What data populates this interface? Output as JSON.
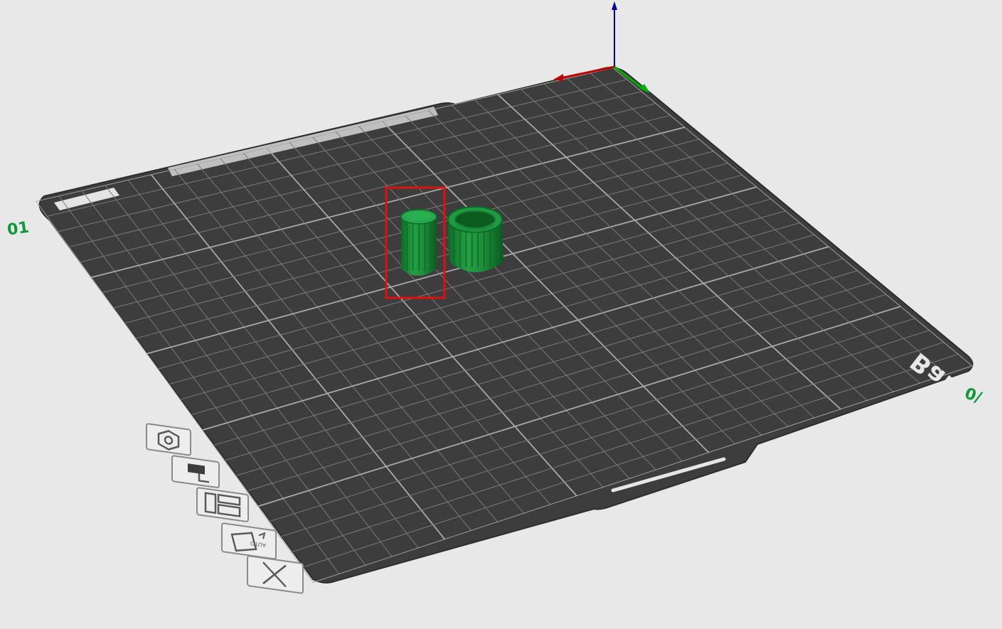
{
  "app": {
    "view": "3D Prepare View"
  },
  "plate": {
    "label": "Bambu Textured PEI Plate",
    "number_left": "01",
    "number_right": "0/"
  },
  "objects": [
    {
      "name": "knob-cylinder",
      "selected": true,
      "color": "#1f8f3a"
    },
    {
      "name": "ring-cylinder",
      "selected": false,
      "color": "#1f8f3a"
    }
  ],
  "side_toolbar": {
    "items": [
      {
        "name": "tool-orient",
        "icon": "hexagon-icon"
      },
      {
        "name": "tool-plate-settings",
        "icon": "plate-settings-icon"
      },
      {
        "name": "tool-arrange",
        "icon": "arrange-icon"
      },
      {
        "name": "tool-auto-orient",
        "icon": "auto-orient-icon"
      },
      {
        "name": "tool-delete-plate",
        "icon": "close-icon"
      }
    ]
  },
  "colors": {
    "background": "#e8e8e8",
    "plate": "#3d3d3d",
    "grid": "#8a8a8a",
    "object": "#1f8f3a",
    "selection": "#e01010",
    "axis_x": "#c00000",
    "axis_y": "#00b000",
    "axis_z": "#0000a0",
    "plate_number": "#0a9a3a"
  }
}
